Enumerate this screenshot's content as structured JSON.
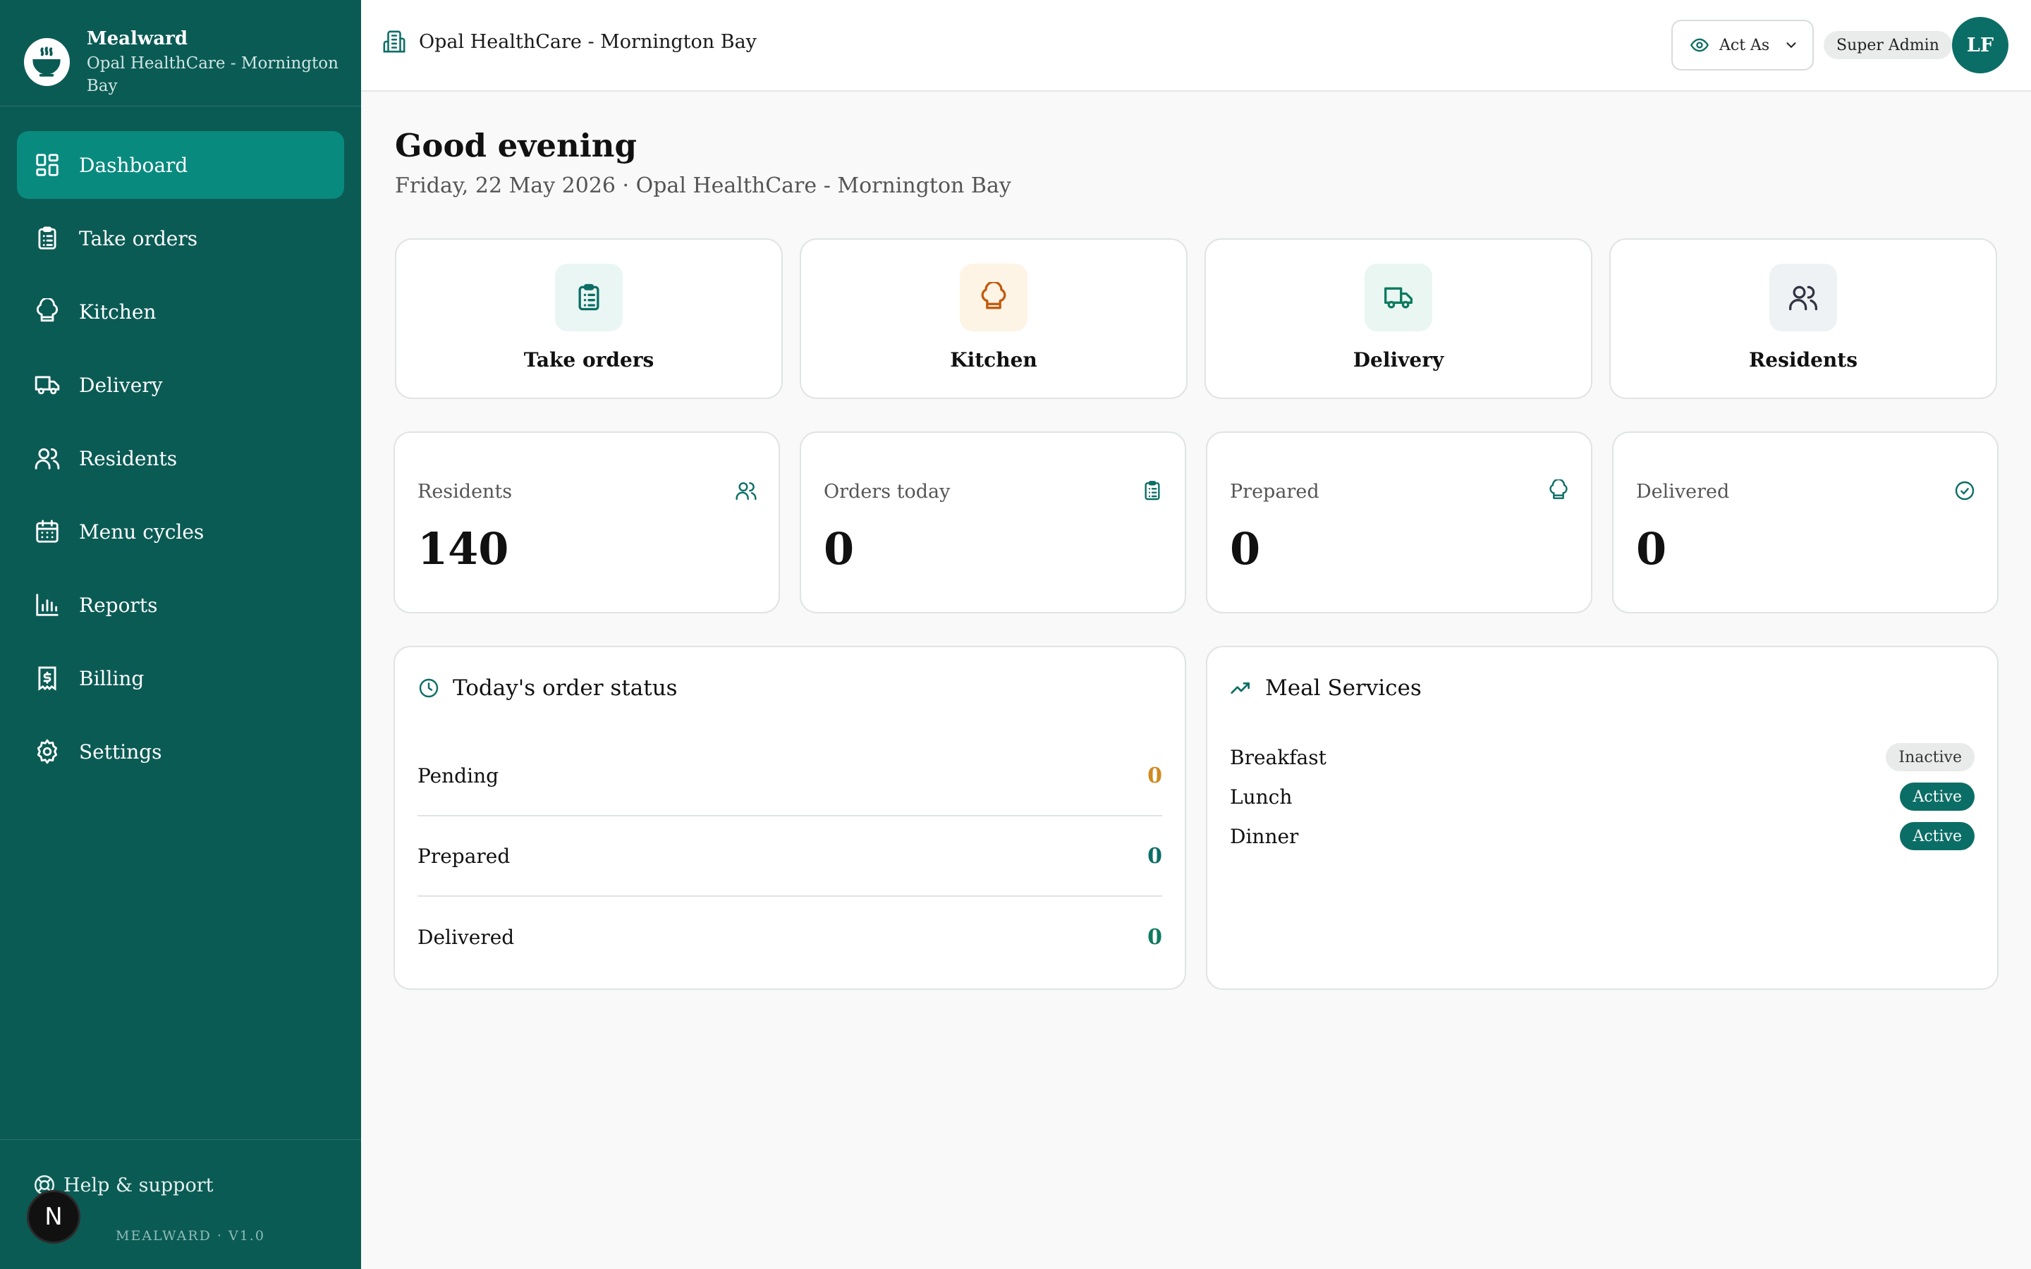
{
  "brand": {
    "name": "Mealward",
    "subtitle": "Opal HealthCare - Mornington Bay"
  },
  "nav": {
    "items": [
      {
        "label": "Dashboard",
        "icon": "dashboard-icon",
        "active": true
      },
      {
        "label": "Take orders",
        "icon": "clipboard-icon"
      },
      {
        "label": "Kitchen",
        "icon": "chef-hat-icon"
      },
      {
        "label": "Delivery",
        "icon": "truck-icon"
      },
      {
        "label": "Residents",
        "icon": "users-icon"
      },
      {
        "label": "Menu cycles",
        "icon": "calendar-icon"
      },
      {
        "label": "Reports",
        "icon": "bar-chart-icon"
      },
      {
        "label": "Billing",
        "icon": "receipt-icon"
      },
      {
        "label": "Settings",
        "icon": "gear-icon"
      }
    ],
    "help_label": "Help & support",
    "version": "MEALWARD · V1.0",
    "dev_badge": "N"
  },
  "topbar": {
    "org_name": "Opal HealthCare - Mornington Bay",
    "act_as_label": "Act As",
    "role": "Super Admin",
    "avatar_initials": "LF"
  },
  "main": {
    "greeting": "Good evening",
    "subtitle": "Friday, 22 May 2026 · Opal HealthCare - Mornington Bay",
    "quick_actions": [
      {
        "label": "Take orders",
        "icon": "clipboard-icon"
      },
      {
        "label": "Kitchen",
        "icon": "chef-hat-icon"
      },
      {
        "label": "Delivery",
        "icon": "truck-icon"
      },
      {
        "label": "Residents",
        "icon": "users-icon"
      }
    ],
    "stats": [
      {
        "label": "Residents",
        "value": "140",
        "icon": "users-icon"
      },
      {
        "label": "Orders today",
        "value": "0",
        "icon": "clipboard-icon"
      },
      {
        "label": "Prepared",
        "value": "0",
        "icon": "chef-hat-icon"
      },
      {
        "label": "Delivered",
        "value": "0",
        "icon": "check-circle-icon"
      }
    ],
    "order_status": {
      "title": "Today's order status",
      "rows": [
        {
          "label": "Pending",
          "value": "0"
        },
        {
          "label": "Prepared",
          "value": "0"
        },
        {
          "label": "Delivered",
          "value": "0"
        }
      ]
    },
    "meal_services": {
      "title": "Meal Services",
      "rows": [
        {
          "label": "Breakfast",
          "status": "Inactive"
        },
        {
          "label": "Lunch",
          "status": "Active"
        },
        {
          "label": "Dinner",
          "status": "Active"
        }
      ]
    }
  },
  "colors": {
    "sidebar": "#0b5b55",
    "active_nav": "#098a7f",
    "accent": "#0b6e66",
    "pending": "#d08a1f"
  }
}
